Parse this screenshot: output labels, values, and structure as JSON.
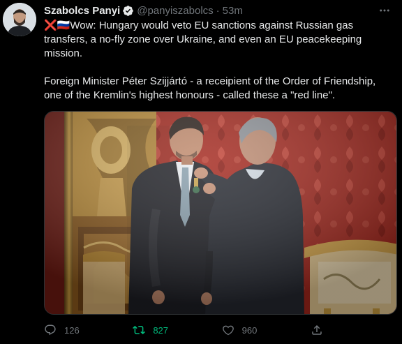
{
  "tweet": {
    "author_name": "Szabolcs Panyi",
    "handle": "@panyiszabolcs",
    "separator": "·",
    "time": "53m",
    "flag_emoji": "❌🇷🇺",
    "paragraph1": "Wow: Hungary would veto EU sanctions against Russian gas transfers, a no-fly zone over Ukraine, and even an EU peacekeeping mission.",
    "paragraph2": "Foreign Minister Péter Szijjártó - a receipient of the Order of Friendship, one of the Kremlin's highest honours - called these a \"red line\".",
    "replies": "126",
    "retweets": "827",
    "likes": "960"
  },
  "icons": {
    "verified": "verified-badge-icon",
    "more": "more-icon",
    "reply": "reply-icon",
    "retweet": "retweet-icon",
    "like": "like-icon",
    "share": "share-icon"
  },
  "colors": {
    "background": "#000000",
    "text": "#e7e9ea",
    "secondary": "#71767b",
    "retweet_active": "#00ba7c",
    "verified": "#e7e9ea"
  }
}
